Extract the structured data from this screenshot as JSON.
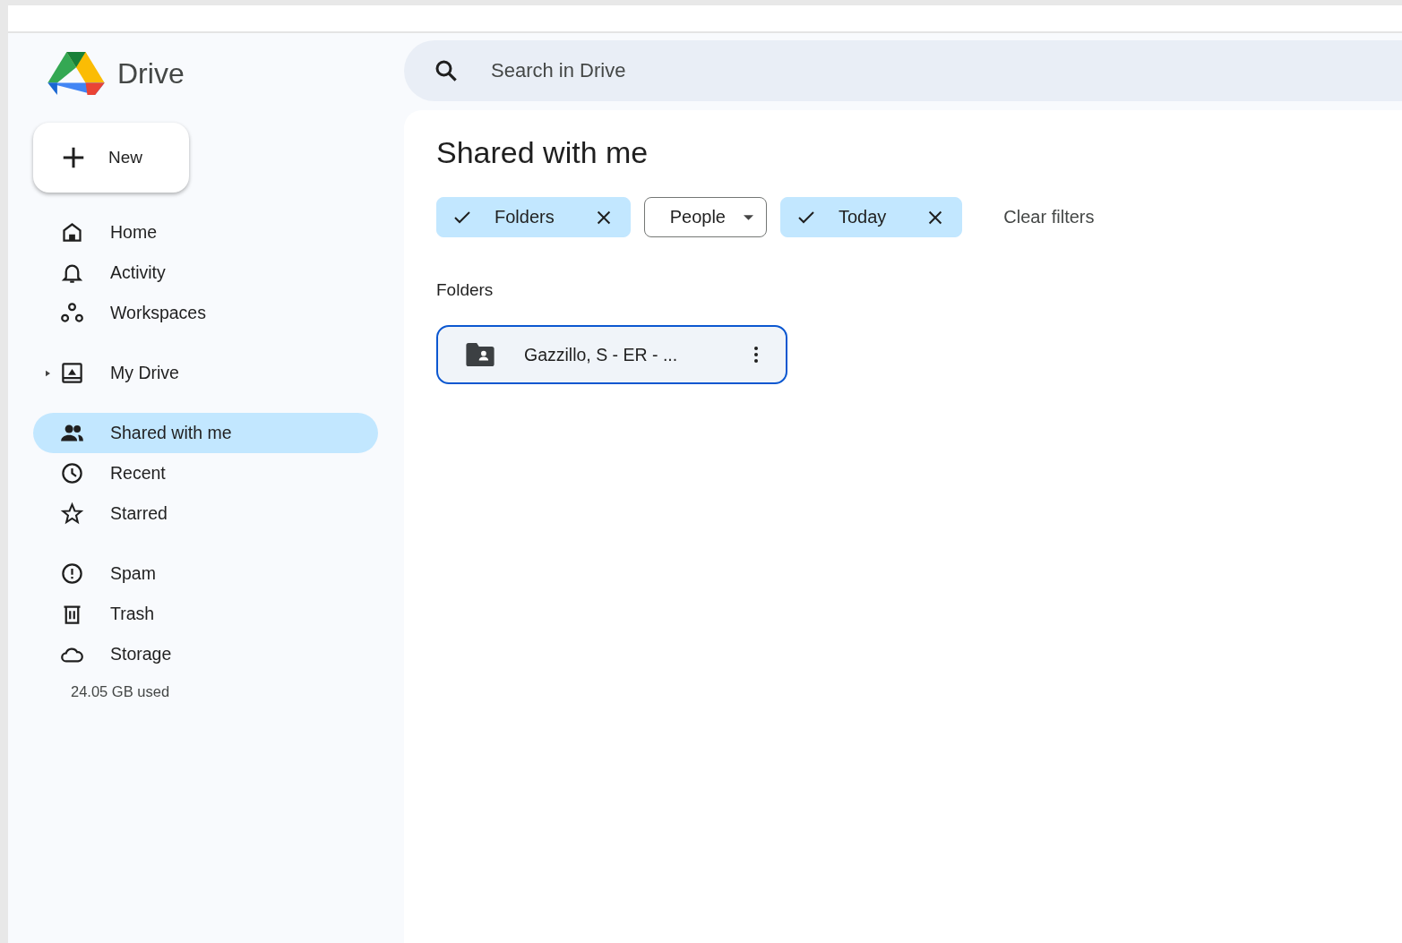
{
  "app": {
    "title": "Drive"
  },
  "new_button": {
    "label": "New"
  },
  "sidebar": {
    "sections": [
      [
        {
          "label": "Home",
          "selected": false
        },
        {
          "label": "Activity",
          "selected": false
        },
        {
          "label": "Workspaces",
          "selected": false
        }
      ],
      [
        {
          "label": "My Drive",
          "selected": false,
          "expanded": false
        }
      ],
      [
        {
          "label": "Shared with me",
          "selected": true
        },
        {
          "label": "Recent",
          "selected": false
        },
        {
          "label": "Starred",
          "selected": false
        }
      ],
      [
        {
          "label": "Spam",
          "selected": false
        },
        {
          "label": "Trash",
          "selected": false
        },
        {
          "label": "Storage",
          "selected": false
        }
      ]
    ],
    "storage_used": "24.05 GB used"
  },
  "search": {
    "placeholder": "Search in Drive"
  },
  "page_title": "Shared with me",
  "filters": [
    {
      "kind": "toggle",
      "label": "Folders",
      "selected": true
    },
    {
      "kind": "dropdown",
      "label": "People",
      "selected": false
    },
    {
      "kind": "toggle",
      "label": "Today",
      "selected": true
    }
  ],
  "clear_filters": "Clear filters",
  "folders_heading": "Folders",
  "folders": [
    {
      "name": "Gazzillo, S - ER - ...",
      "selected": true
    }
  ]
}
